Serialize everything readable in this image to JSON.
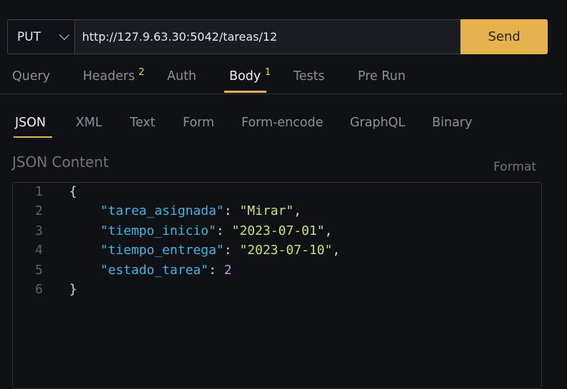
{
  "request": {
    "method": "PUT",
    "url": "http://127.9.63.30:5042/tareas/12",
    "send_label": "Send"
  },
  "main_tabs": [
    {
      "label": "Query",
      "count": ""
    },
    {
      "label": "Headers",
      "count": "2"
    },
    {
      "label": "Auth",
      "count": ""
    },
    {
      "label": "Body",
      "count": "1"
    },
    {
      "label": "Tests",
      "count": ""
    },
    {
      "label": "Pre Run",
      "count": ""
    }
  ],
  "active_main_tab": "Body",
  "body_tabs": [
    "JSON",
    "XML",
    "Text",
    "Form",
    "Form-encode",
    "GraphQL",
    "Binary"
  ],
  "active_body_tab": "JSON",
  "section_title": "JSON Content",
  "format_label": "Format",
  "editor": {
    "line_numbers": [
      "1",
      "2",
      "3",
      "4",
      "5",
      "6"
    ],
    "lines": [
      [
        {
          "t": "punct",
          "v": "{"
        }
      ],
      [
        {
          "t": "pad",
          "v": "    "
        },
        {
          "t": "key",
          "v": "\"tarea_asignada\""
        },
        {
          "t": "punct",
          "v": ": "
        },
        {
          "t": "str",
          "v": "\"Mirar\""
        },
        {
          "t": "punct",
          "v": ","
        }
      ],
      [
        {
          "t": "pad",
          "v": "    "
        },
        {
          "t": "key",
          "v": "\"tiempo_inicio\""
        },
        {
          "t": "punct",
          "v": ": "
        },
        {
          "t": "str",
          "v": "\"2023-07-01\""
        },
        {
          "t": "punct",
          "v": ","
        }
      ],
      [
        {
          "t": "pad",
          "v": "    "
        },
        {
          "t": "key",
          "v": "\"tiempo_entrega\""
        },
        {
          "t": "punct",
          "v": ": "
        },
        {
          "t": "str",
          "v": "\"2023-07-10\""
        },
        {
          "t": "punct",
          "v": ","
        }
      ],
      [
        {
          "t": "pad",
          "v": "    "
        },
        {
          "t": "key",
          "v": "\"estado_tarea\""
        },
        {
          "t": "punct",
          "v": ": "
        },
        {
          "t": "num",
          "v": "2"
        }
      ],
      [
        {
          "t": "punct",
          "v": "}"
        }
      ]
    ]
  },
  "colors": {
    "accent": "#e5b24d",
    "background": "#0f1115",
    "json_key": "#3fb4e0",
    "json_string": "#c6e07a",
    "json_number": "#c792ea",
    "tab_count": "#e8d25a"
  }
}
